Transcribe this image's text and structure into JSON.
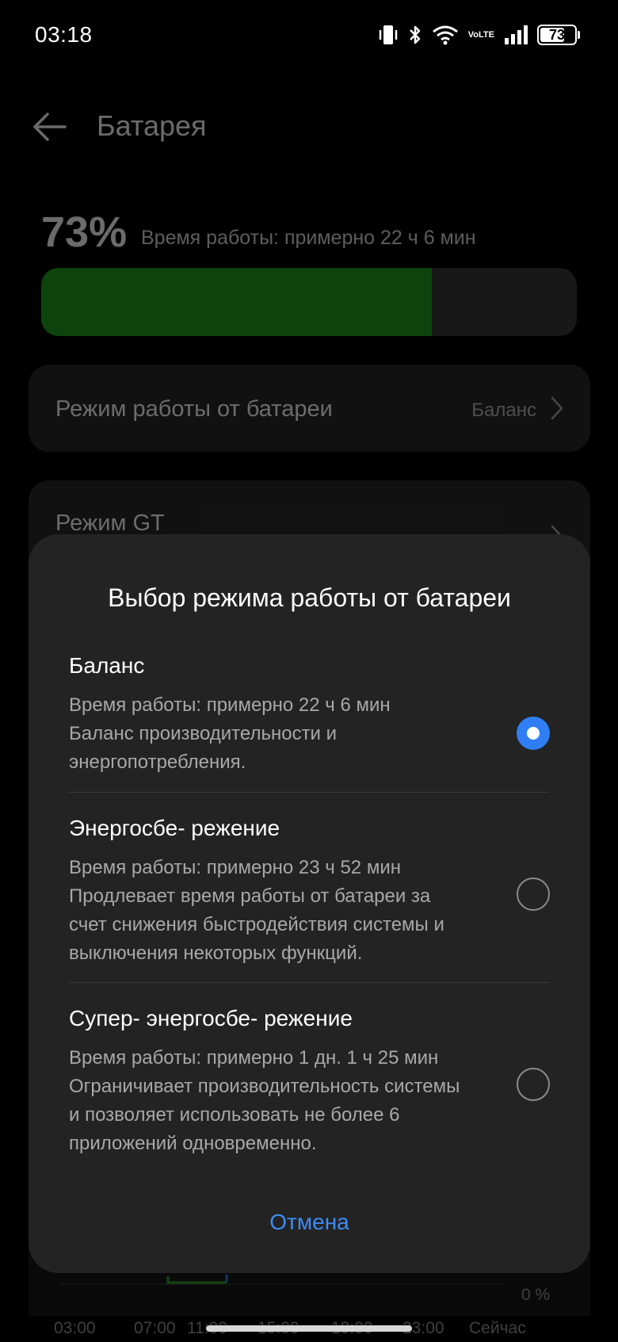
{
  "status_bar": {
    "time": "03:18",
    "volte_top": "Vo",
    "volte_bottom": "LTE",
    "battery": "73",
    "battery_fraction": 0.73
  },
  "header": {
    "title": "Батарея"
  },
  "battery": {
    "percent": "73%",
    "runtime": "Время работы: примерно 22 ч 6 мин",
    "level": 0.73,
    "bar_color": "#1f9f1f"
  },
  "settings": {
    "mode_label": "Режим работы от батареи",
    "mode_value": "Баланс",
    "gt_label": "Режим GT"
  },
  "chart": {
    "bottom_label": "0 %",
    "x_ticks": [
      "03:00",
      "07:00",
      "11:00",
      "15:00",
      "19:00",
      "23:00",
      "Сейчас"
    ]
  },
  "dialog": {
    "title": "Выбор режима работы от батареи",
    "options": [
      {
        "title": "Баланс",
        "runtime": "Время работы: примерно 22 ч 6 мин",
        "description": "Баланс производительности и энергопотребления.",
        "selected": true
      },
      {
        "title": "Энергосбе- режение",
        "runtime": "Время работы: примерно 23 ч 52 мин",
        "description": "Продлевает время работы от батареи за счет снижения быстродействия системы и выключения некоторых функций.",
        "selected": false
      },
      {
        "title": "Супер- энергосбе- режение",
        "runtime": "Время работы: примерно 1 дн. 1 ч 25 мин",
        "description": "Ограничивает производительность системы и позволяет использовать не более 6 приложений одновременно.",
        "selected": false
      }
    ],
    "cancel_label": "Отмена"
  },
  "colors": {
    "accent": "#2f7ef5",
    "cancel": "#3d8cf5"
  }
}
